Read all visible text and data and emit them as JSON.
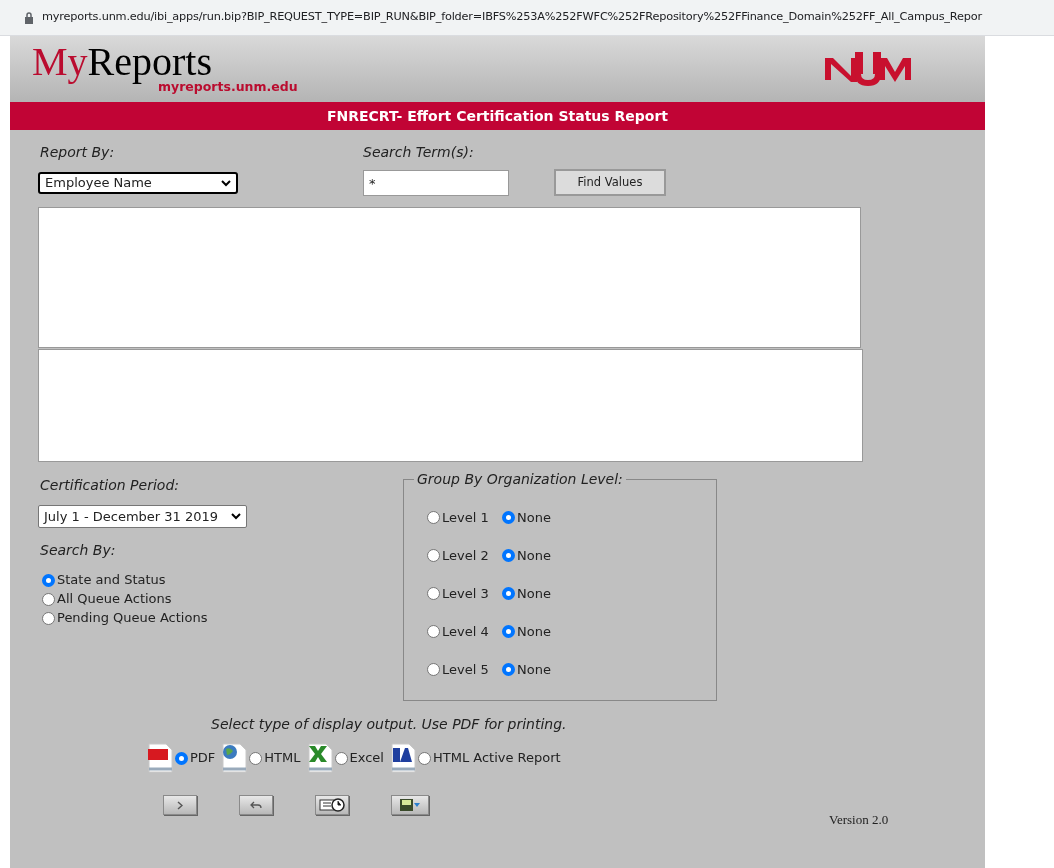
{
  "address_bar": {
    "url": "myreports.unm.edu/ibi_apps/run.bip?BIP_REQUEST_TYPE=BIP_RUN&BIP_folder=IBFS%253A%252FWFC%252FRepository%252FFinance_Domain%252FF_All_Campus_Repor"
  },
  "header": {
    "brand_first": "My",
    "brand_rest": "Reports",
    "subtitle": "myreports.unm.edu"
  },
  "title_bar": {
    "title": "FNRECRT- Effort Certification Status Report"
  },
  "report_by": {
    "label": "Report By:",
    "value": "Employee Name"
  },
  "search_terms": {
    "label": "Search Term(s):",
    "value": "*"
  },
  "find_button": {
    "label": "Find Values"
  },
  "certification_period": {
    "label": "Certification Period:",
    "value": "July 1 - December 31 2019"
  },
  "search_by": {
    "label": "Search By:",
    "options": [
      {
        "label": "State and Status",
        "selected": true
      },
      {
        "label": "All Queue Actions",
        "selected": false
      },
      {
        "label": "Pending Queue Actions",
        "selected": false
      }
    ]
  },
  "group_by": {
    "legend": "Group By Organization Level:",
    "rows": [
      {
        "level_label": "Level 1",
        "level_selected": false,
        "none_label": "None",
        "none_selected": true
      },
      {
        "level_label": "Level 2",
        "level_selected": false,
        "none_label": "None",
        "none_selected": true
      },
      {
        "level_label": "Level 3",
        "level_selected": false,
        "none_label": "None",
        "none_selected": true
      },
      {
        "level_label": "Level 4",
        "level_selected": false,
        "none_label": "None",
        "none_selected": true
      },
      {
        "level_label": "Level 5",
        "level_selected": false,
        "none_label": "None",
        "none_selected": true
      }
    ]
  },
  "output": {
    "instruction": "Select type of display output. Use PDF for printing.",
    "options": [
      {
        "kind": "pdf",
        "label": "PDF",
        "selected": true
      },
      {
        "kind": "html",
        "label": "HTML",
        "selected": false
      },
      {
        "kind": "excel",
        "label": "Excel",
        "selected": false
      },
      {
        "kind": "active",
        "label": "HTML Active Report",
        "selected": false
      }
    ]
  },
  "version": "Version 2.0"
}
